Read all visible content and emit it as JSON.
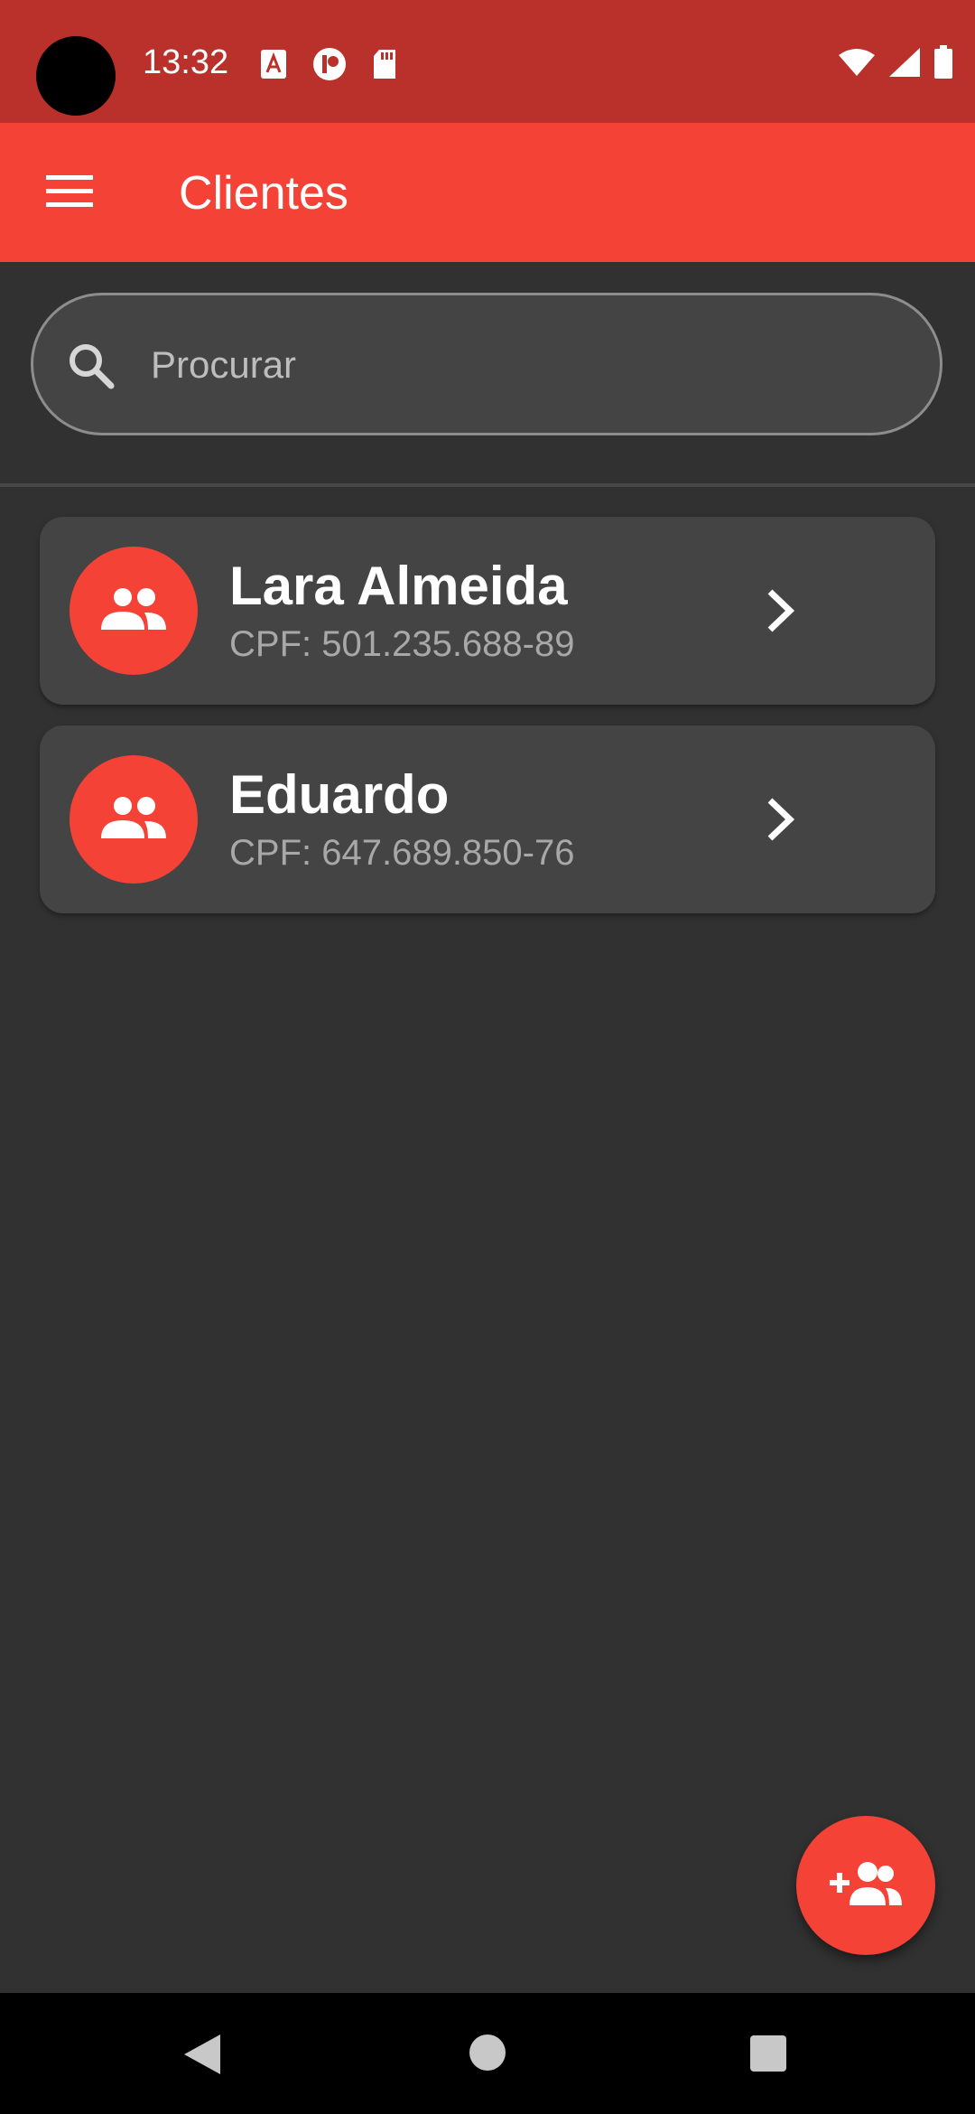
{
  "status_bar": {
    "time": "13:32",
    "icons": [
      "a-notification-icon",
      "p-notification-icon",
      "sd-card-icon",
      "wifi-icon",
      "signal-icon",
      "battery-icon"
    ]
  },
  "app_bar": {
    "title": "Clientes",
    "menu_icon": "menu-icon"
  },
  "search": {
    "placeholder": "Procurar",
    "value": "",
    "icon": "search-icon"
  },
  "clients": [
    {
      "name": "Lara Almeida",
      "cpf": "CPF: 501.235.688-89"
    },
    {
      "name": "Eduardo",
      "cpf": "CPF: 647.689.850-76"
    }
  ],
  "fab": {
    "icon": "add-group-icon"
  },
  "nav": {
    "back": "back-icon",
    "home": "home-icon",
    "recents": "recents-icon"
  },
  "colors": {
    "primary": "#f44336",
    "status_bar": "#b9312a",
    "background": "#313131",
    "card": "#444444"
  }
}
